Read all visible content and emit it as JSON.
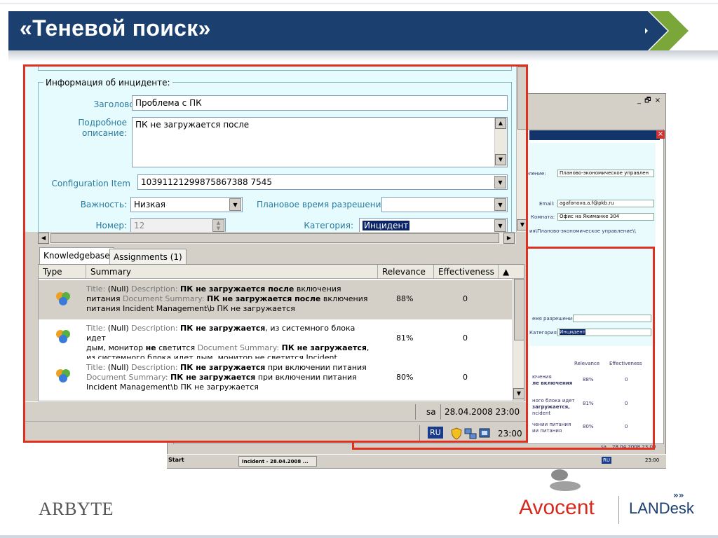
{
  "slide": {
    "title": "«Теневой поиск»",
    "logos": {
      "left": "ARBYTE",
      "middle": "Avocent",
      "right": "LANDesk"
    },
    "colors": {
      "banner": "#1b3f6e",
      "chevron": "#7aa63a",
      "outline": "#e03020",
      "form_bg": "#e6fbfd"
    }
  },
  "form": {
    "group_title": "Информация об инциденте:",
    "title_label": "Заголовок:",
    "title_value": "Проблема с ПК",
    "description_label_1": "Подробное",
    "description_label_2": "описание:",
    "description_value": "ПК не загружается после",
    "ci_label": "Configuration Item",
    "ci_value": "10391121299875867388 7545",
    "priority_label": "Важность:",
    "priority_value": "Низкая",
    "planned_label": "Плановое время разрешения:",
    "planned_value": "",
    "number_label": "Номер:",
    "number_value": "12",
    "category_label": "Категория:",
    "category_value": "Инцидент"
  },
  "tabs": [
    {
      "label": "Knowledgebase",
      "active": true
    },
    {
      "label": "Assignments (1)",
      "active": false
    }
  ],
  "grid": {
    "headers": [
      "Type",
      "Summary",
      "Relevance",
      "Effectiveness"
    ],
    "rows": [
      {
        "line1": [
          "Title: ",
          "(Null)",
          " Description: ",
          "ПК не загружается после",
          " включения"
        ],
        "line2": [
          "питания ",
          "Document Summary: ",
          "ПК не загружается после",
          " включения"
        ],
        "line3": "питания Incident Management\\b ПК не загружается",
        "relevance": "88%",
        "effectiveness": "0"
      },
      {
        "line1": [
          "Title: ",
          "(Null)",
          " Description: ",
          "ПК не загружается",
          ", из системного блока идет"
        ],
        "line2": [
          "дым, монитор ",
          "не",
          " светится ",
          "Document Summary: ",
          "ПК не загружается",
          ","
        ],
        "line3": "из системного блока идет дым, монитор не светится Incident",
        "relevance": "81%",
        "effectiveness": "0"
      },
      {
        "line1": [
          "Title: ",
          "(Null)",
          " Description: ",
          "ПК не загружается",
          " при включении питания"
        ],
        "line2": [
          "Document Summary: ",
          "ПК не загружается",
          " при включении питания"
        ],
        "line3": "Incident Management\\b ПК не загружается",
        "relevance": "80%",
        "effectiveness": "0"
      }
    ]
  },
  "status": {
    "user": "sa",
    "datetime": "28.04.2008 23:00"
  },
  "tray": {
    "lang": "RU",
    "time": "23:00"
  },
  "background_window": {
    "controls": "_ 🗗 ×",
    "department_label": "деление:",
    "department_value": "Планово-экономическое управлен",
    "email_label": "Email:",
    "email_value": "agafonova.a.f@pkb.ru",
    "room_label": "Комната:",
    "room_value": "Офис на Якиманке 304",
    "path_value": "ия\\Планово-экономическое управление\\\\",
    "planned_label": "емя разрешения:",
    "category_label": "Категория:",
    "category_value": "Инцидент",
    "headers": [
      "Relevance",
      "Effectiveness"
    ],
    "rows": [
      {
        "text1": "ючения",
        "text2": "ле включения",
        "rel": "88%",
        "eff": "0"
      },
      {
        "text1": "ного блока идет",
        "text2": "загружается,",
        "text3": "ncident",
        "rel": "81%",
        "eff": "0"
      },
      {
        "text1": "чении питания",
        "text2": "ии питания",
        "rel": "80%",
        "eff": "0"
      }
    ],
    "status_user": "sa",
    "status_date": "28.04.2008 23:00",
    "taskbar_start": "Start",
    "taskbar_task": "Incident - 28.04.2008 ...",
    "taskbar_lang": "RU",
    "taskbar_time": "23:00"
  }
}
